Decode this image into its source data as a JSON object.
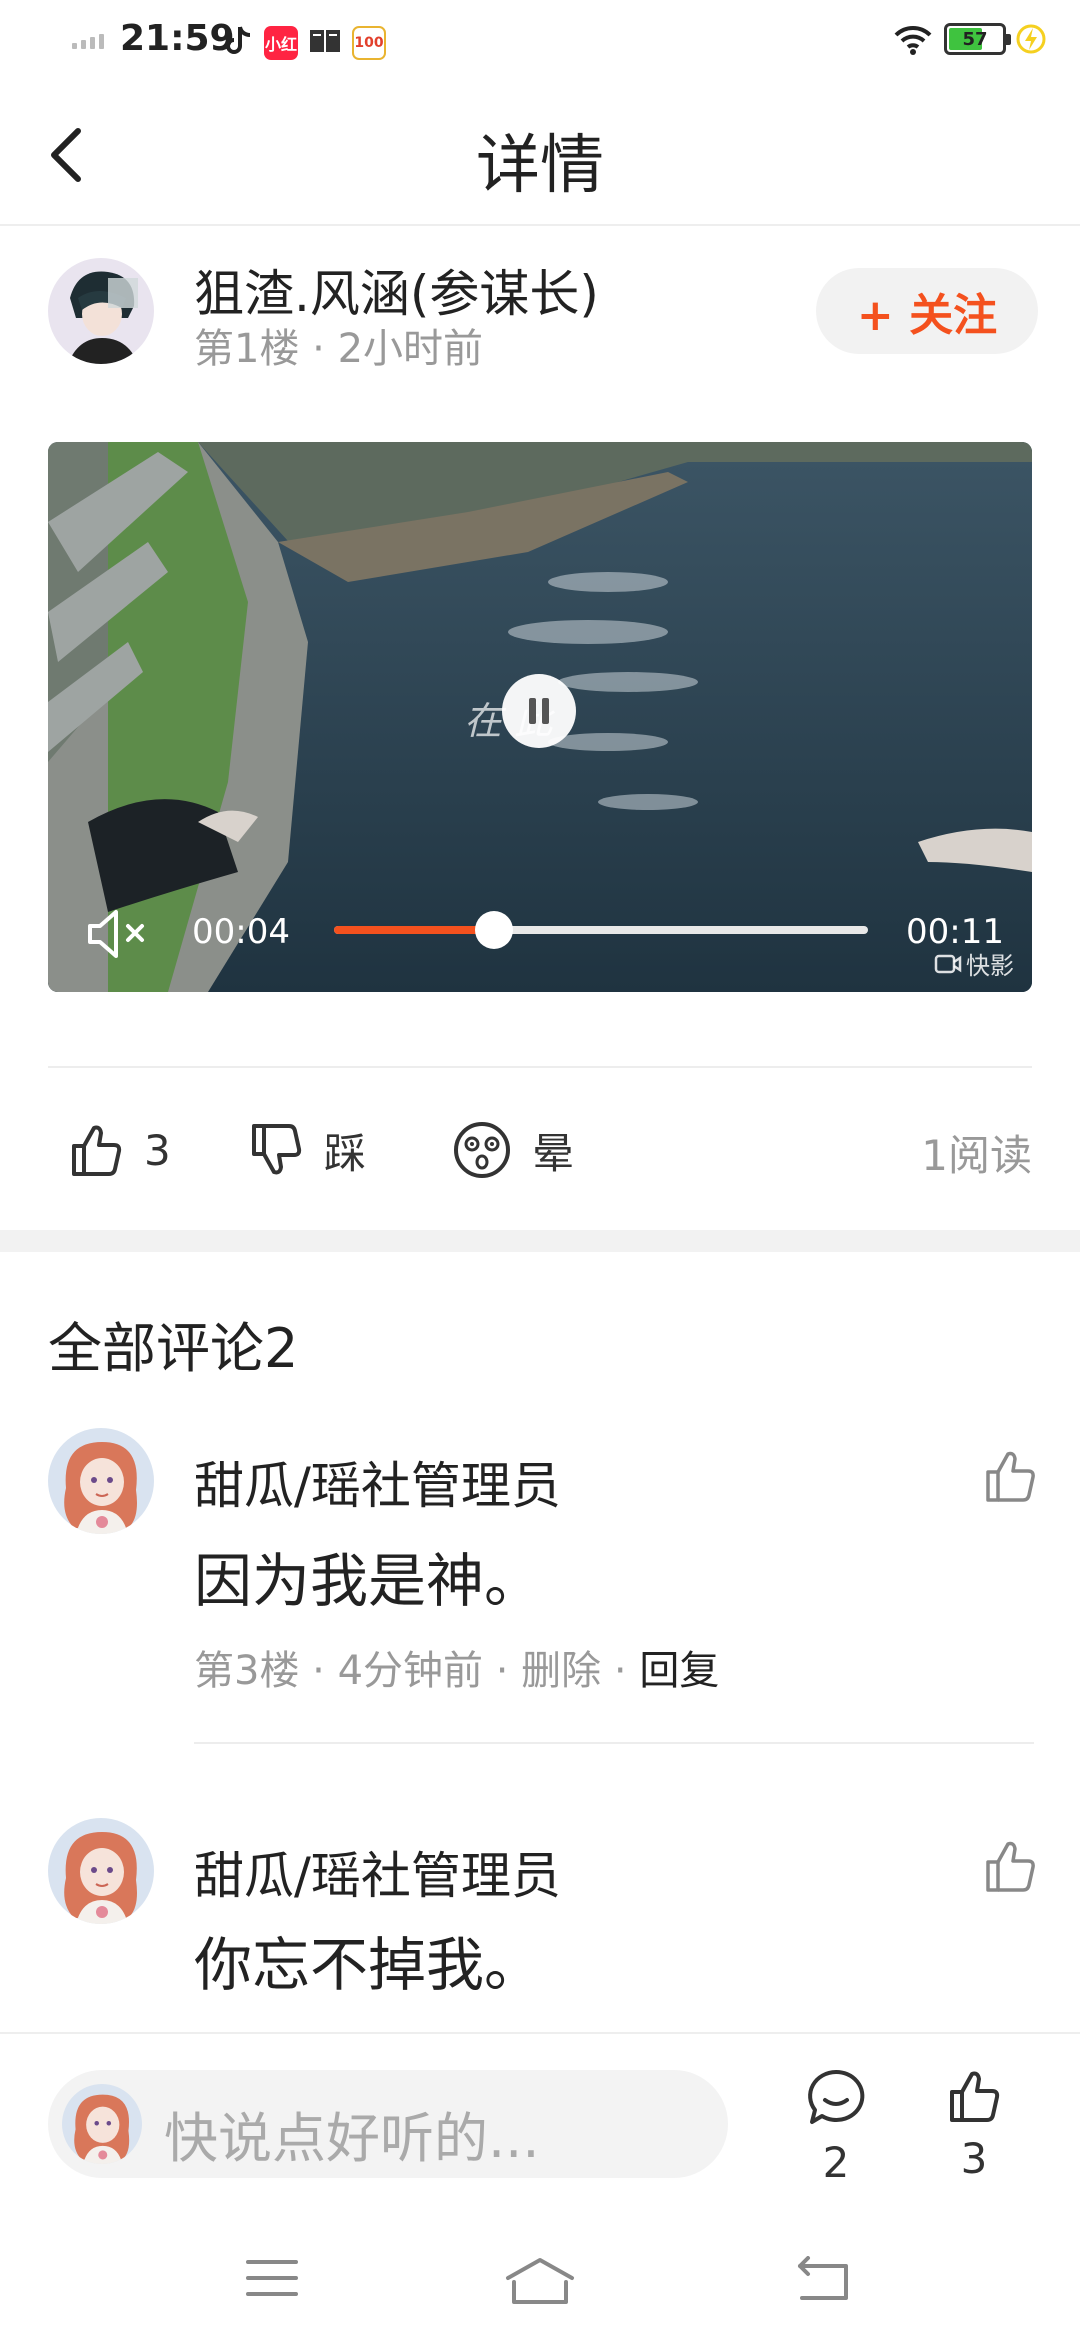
{
  "status_bar": {
    "time": "21:59",
    "battery_level": "57",
    "app_icons": [
      "tiktok-icon",
      "xiaohongshu-icon",
      "book-icon",
      "yuanfudao-icon"
    ]
  },
  "header": {
    "title": "详情"
  },
  "post": {
    "author_name": "狙渣.风涵(参谋长)",
    "meta": "第1楼 · 2小时前",
    "follow_label": "+ 关注"
  },
  "video": {
    "current_time": "00:04",
    "total_time": "00:11",
    "progress": 0.3,
    "watermark": "快影",
    "overlay_text": "在 此",
    "muted": true,
    "state": "playing"
  },
  "reactions": {
    "like_count": "3",
    "dislike_label": "踩",
    "dizzy_label": "晕",
    "read_count": "1阅读"
  },
  "comments_section": {
    "title": "全部评论2"
  },
  "comments": [
    {
      "author": "甜瓜/瑶社管理员",
      "text": "因为我是神。",
      "meta": "第3楼 · 4分钟前 · 删除 · ",
      "reply_label": "回复"
    },
    {
      "author": "甜瓜/瑶社管理员",
      "text": "你忘不掉我。"
    }
  ],
  "bottom_bar": {
    "input_placeholder": "快说点好听的...",
    "comment_count": "2",
    "like_count": "3"
  },
  "colors": {
    "accent": "#f4511e",
    "muted_text": "#999999",
    "battery_green": "#3fc33f"
  }
}
